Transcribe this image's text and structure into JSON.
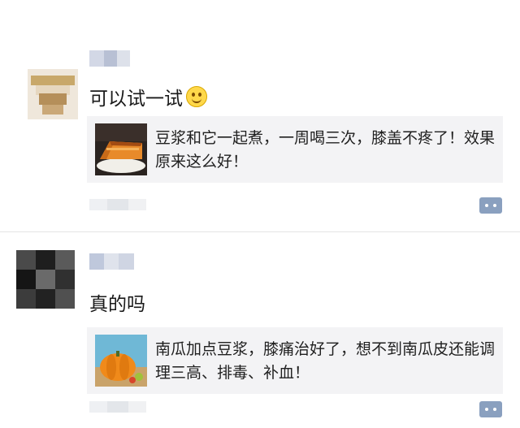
{
  "posts": [
    {
      "text": "可以试一试",
      "emoji": "smile-emoji",
      "card_text": "豆浆和它一起煮，一周喝三次，膝盖不疼了！效果原来这么好！",
      "thumb": "pumpkin-cake-image"
    },
    {
      "text": "真的吗",
      "card_text": "南瓜加点豆浆，膝痛治好了，想不到南瓜皮还能调理三高、排毒、补血！",
      "thumb": "pumpkin-image"
    }
  ],
  "colors": {
    "card_bg": "#f3f3f5",
    "comment_button": "#8aa0bf",
    "divider": "#e4e4e4"
  }
}
